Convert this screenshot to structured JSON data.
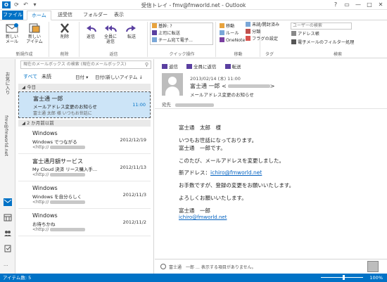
{
  "window": {
    "app_icon": "O",
    "title": "受信トレイ - fmv@fmworld.net - Outlook",
    "controls": [
      "?",
      "▭",
      "—",
      "□",
      "✕"
    ]
  },
  "ribbon_tabs": {
    "file": "ファイル",
    "tabs": [
      "ホーム",
      "送受信",
      "フォルダー",
      "表示"
    ],
    "active": "ホーム"
  },
  "ribbon": {
    "new_email": "新しい\nメール",
    "new_items": "新しい\nアイテム",
    "group_new": "新規作成",
    "delete": "削除",
    "group_delete": "削除",
    "reply": "返信",
    "reply_all": "全員に\n返信",
    "forward": "転送",
    "group_respond": "返信",
    "quick_steps": [
      "基幹: ?",
      "上司に転送",
      "チーム宛て電子..."
    ],
    "group_quick": "クイック操作",
    "move": "移動",
    "rules": "ルール",
    "onenote": "OneNote",
    "group_move": "移動",
    "unread": "未読/開封済み",
    "categorize": "分類",
    "followup": "フラグの設定",
    "group_tags": "タグ",
    "search_people_placeholder": "ユーザーの検索",
    "address_book": "アドレス帳",
    "filter_email": "電子メールのフィルター処理",
    "group_find": "検索"
  },
  "nav": {
    "favorites": "お気に入り",
    "inbox_folder": "fmv@fmworld.net"
  },
  "message_list": {
    "search_placeholder": "現在のメールボックス の検索",
    "search_scope": "現在のメールボックス",
    "filters": [
      "すべて",
      "未読"
    ],
    "sort_by": "日付",
    "sort_order": "日付(新しいアイテム",
    "sections": [
      "今日",
      "2 か月前以前"
    ],
    "messages": [
      {
        "from": "富士通 一郎",
        "subject": "メールアドレス変更のお知らせ",
        "preview": "富士通 太郎 様 いつもお世話に",
        "date": "11:00",
        "selected": true
      },
      {
        "from": "Windows",
        "subject": "Windows でつながる",
        "preview": "<http://",
        "date": "2012/12/19",
        "selected": false
      },
      {
        "from": "富士通月額サービス",
        "subject": "My Cloud 決済 リース購入手...",
        "preview": "<http://",
        "date": "2012/11/13",
        "selected": false
      },
      {
        "from": "Windows",
        "subject": "Windows を自分らしく",
        "preview": "<http://",
        "date": "2012/11/3",
        "selected": false
      },
      {
        "from": "Windows",
        "subject": "お待ちかね",
        "preview": "<http://",
        "date": "2012/11/2",
        "selected": false
      }
    ]
  },
  "reading_pane": {
    "actions": [
      "返信",
      "全員に返信",
      "転送"
    ],
    "date": "2013/02/14 (木) 11:00",
    "from": "富士通 一郎 <",
    "subject": "メールアドレス変更のお知らせ",
    "to_label": "宛先",
    "body": [
      "富士通　太郎　様",
      "いつもお世話になっております。",
      "富士通　一郎です。",
      "このたび、メールアドレスを変更しました。",
      "新アドレス：",
      "お手数ですが、登録の変更をお願いいたします。",
      "よろしくお願いいたします。",
      "富士通　一郎"
    ],
    "new_address": "ichiro@fmworld.net",
    "signature_email": "ichiro@fmworld.net",
    "people_pane_text": "富士通　一郎 … 表示する項目がありません。"
  },
  "status_bar": {
    "items": "アイテム数: 5",
    "zoom": "100%"
  },
  "colors": {
    "accent": "#0072c6",
    "selected_row": "#cce4f7",
    "link": "#0563c1"
  }
}
